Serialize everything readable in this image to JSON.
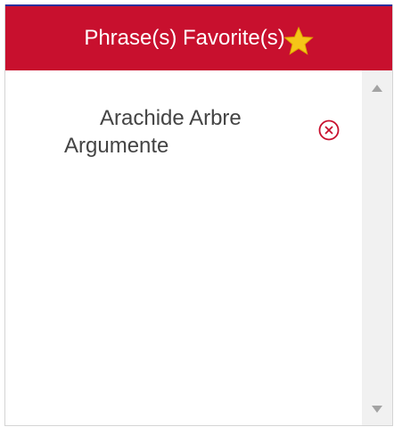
{
  "header": {
    "title": "Phrase(s) Favorite(s)",
    "star_icon": "star-icon",
    "background_color": "#c8102e",
    "top_border_color": "#2c2f9c"
  },
  "favorites": [
    {
      "text": "Arachide Arbre Argumente",
      "remove_icon": "close-circle-icon"
    }
  ],
  "scrollbar": {
    "up_icon": "triangle-up-icon",
    "down_icon": "triangle-down-icon"
  },
  "colors": {
    "accent": "#c8102e",
    "remove_icon": "#c8102e",
    "star": "#f5c518"
  }
}
